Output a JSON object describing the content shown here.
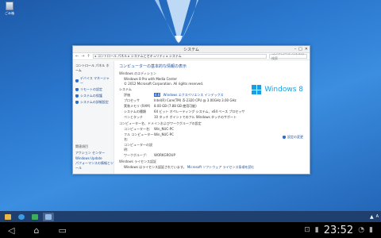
{
  "desktop": {
    "recycle_bin_label": "ごみ箱"
  },
  "window": {
    "title": "システム",
    "controls": [
      "–",
      "□",
      "✕"
    ],
    "address_path": "▸ コントロール パネル ▸ システムとセキュリティ ▸ システム",
    "search_placeholder": "コントロール パネルの検索"
  },
  "sidebar": {
    "home": "コントロール パネル ホーム",
    "items": [
      {
        "label": "デバイス マネージャー"
      },
      {
        "label": "リモートの設定"
      },
      {
        "label": "システムの保護"
      },
      {
        "label": "システムの詳細設定"
      }
    ],
    "related_header": "関連項目",
    "related_links": [
      "アクション センター",
      "Windows Update",
      "パフォーマンスの情報とツール"
    ]
  },
  "main": {
    "heading": "コンピューターの基本的な情報の表示",
    "edition_header": "Windows のエディション",
    "edition_name": "Windows 8 Pro with Media Center",
    "copyright": "© 2012 Microsoft Corporation. All rights reserved.",
    "system_header": "システム",
    "system_rows": [
      {
        "key": "評価",
        "badge": "4.6",
        "value": "Windows エクスペリエンス インデックス"
      },
      {
        "key": "プロセッサ",
        "value": "Intel(R) Core(TM) i5-2320 CPU @ 3.00GHz   3.00 GHz"
      },
      {
        "key": "実装メモリ (RAM)",
        "value": "8.00 GB (7.88 GB 使用可能)"
      },
      {
        "key": "システムの種類",
        "value": "64 ビット オペレーティング システム、x64 ベース プロセッサ"
      },
      {
        "key": "ペンとタッチ",
        "value": "10 タッチ ポイントでのフル Windows タッチのサポート"
      }
    ],
    "computer_header": "コンピューター名、ドメインおよびワークグループの設定",
    "computer_rows": [
      {
        "key": "コンピューター名:",
        "value": "Win_NUC-PC"
      },
      {
        "key": "フル コンピューター名:",
        "value": "Win_NUC-PC"
      },
      {
        "key": "コンピューターの説明:",
        "value": ""
      },
      {
        "key": "ワークグループ:",
        "value": "WORKGROUP"
      }
    ],
    "change_settings": "設定の変更",
    "activation_header": "Windows ライセンス認証",
    "activation_text": "Windows はライセンス認証されています。",
    "activation_link": "Microsoft ソフトウェア ライセンス条項を読む",
    "logo_text": "Windows 8"
  },
  "taskbar": {
    "tray_up": "▲",
    "tray_text": "A"
  },
  "android": {
    "clock": "23:52",
    "nav_back": "◁",
    "nav_home": "⌂",
    "nav_recent": "▭",
    "extra": "⊡"
  }
}
